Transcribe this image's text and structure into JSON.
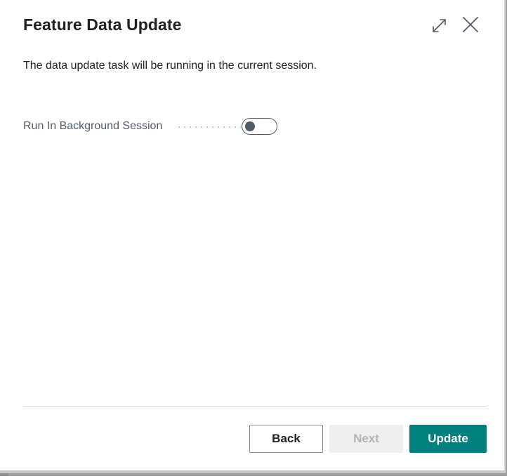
{
  "dialog": {
    "title": "Feature Data Update",
    "description": "The data update task will be running in the current session.",
    "expand_icon": "expand-diagonal-icon",
    "close_icon": "close-icon"
  },
  "field": {
    "label": "Run In Background Session",
    "toggle_state": "off"
  },
  "footer": {
    "back_label": "Back",
    "next_label": "Next",
    "update_label": "Update",
    "accent_color": "#00817f"
  }
}
